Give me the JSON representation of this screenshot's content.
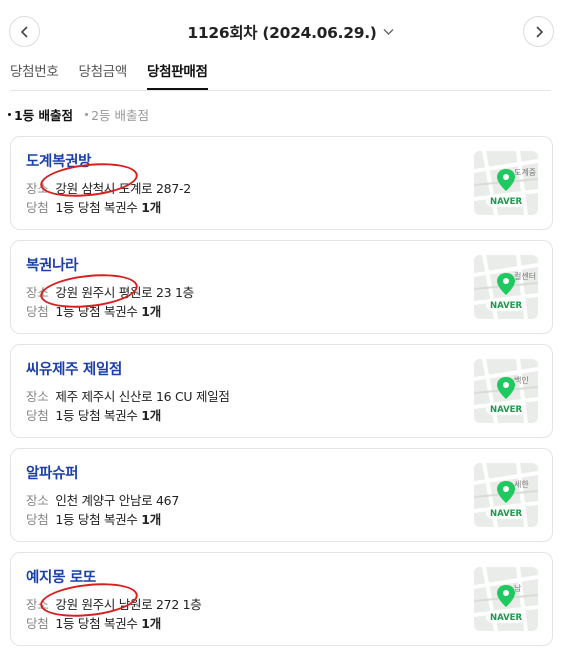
{
  "header": {
    "title": "1126회차 (2024.06.29.)"
  },
  "tabs": [
    {
      "label": "당첨번호"
    },
    {
      "label": "당첨금액"
    },
    {
      "label": "당첨판매점",
      "active": true
    }
  ],
  "sub_tabs": [
    {
      "label": "1등 배출점",
      "active": true
    },
    {
      "label": "2등 배출점",
      "active": false
    }
  ],
  "labels": {
    "address": "장소",
    "winning": "당첨"
  },
  "stores": [
    {
      "name": "도계복권방",
      "address": "강원 삼척시 도계로 287-2",
      "win_text": "1등 당첨 복권수",
      "win_count": "1개",
      "map_badge": "NAVER",
      "map_text": "도계중"
    },
    {
      "name": "복권나라",
      "address": "강원 원주시 평원로 23 1층",
      "win_text": "1등 당첨 복권수",
      "win_count": "1개",
      "map_badge": "NAVER",
      "map_text": "컬센터"
    },
    {
      "name": "씨유제주 제일점",
      "address": "제주 제주시 신산로 16 CU 제일점",
      "win_text": "1등 당첨 복권수",
      "win_count": "1개",
      "map_badge": "NAVER",
      "map_text": "백인"
    },
    {
      "name": "알파슈퍼",
      "address": "인천 계양구 안남로 467",
      "win_text": "1등 당첨 복권수",
      "win_count": "1개",
      "map_badge": "NAVER",
      "map_text": "세한"
    },
    {
      "name": "예지몽 로또",
      "address": "강원 원주시 남원로 272 1층",
      "win_text": "1등 당첨 복권수",
      "win_count": "1개",
      "map_badge": "NAVER",
      "map_text": "남"
    }
  ],
  "colors": {
    "store_name": "#1a3fa6",
    "pin": "#1ec95f",
    "annotation_circle": "#d81f1f"
  }
}
